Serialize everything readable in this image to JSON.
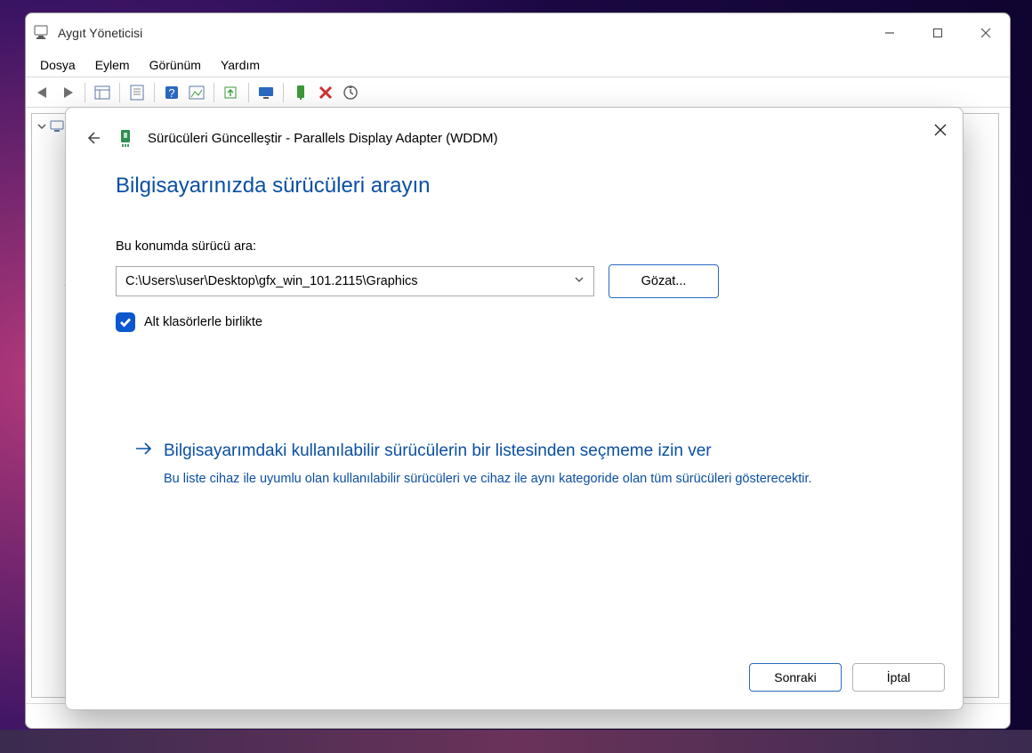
{
  "window": {
    "title": "Aygıt Yöneticisi",
    "menu": {
      "file": "Dosya",
      "action": "Eylem",
      "view": "Görünüm",
      "help": "Yardım"
    }
  },
  "toolbar_icons": [
    "back-icon",
    "forward-icon",
    "show-hide-tree-icon",
    "properties-icon",
    "help-icon",
    "show-hidden-icon",
    "update-driver-icon",
    "monitor-icon",
    "enable-device-icon",
    "disable-device-icon",
    "scan-hardware-icon"
  ],
  "modal": {
    "title": "Sürücüleri Güncelleştir - Parallels Display Adapter (WDDM)",
    "heading": "Bilgisayarınızda sürücüleri arayın",
    "search_label": "Bu konumda sürücü ara:",
    "path_value": "C:\\Users\\user\\Desktop\\gfx_win_101.2115\\Graphics",
    "browse_label": "Gözat...",
    "include_subfolders_label": "Alt klasörlerle birlikte",
    "include_subfolders_checked": true,
    "pick_title": "Bilgisayarımdaki kullanılabilir sürücülerin bir listesinden seçmeme izin ver",
    "pick_desc": "Bu liste cihaz ile uyumlu olan kullanılabilir sürücüleri ve cihaz ile aynı kategoride olan tüm sürücüleri gösterecektir.",
    "next_label": "Sonraki",
    "cancel_label": "İptal"
  }
}
